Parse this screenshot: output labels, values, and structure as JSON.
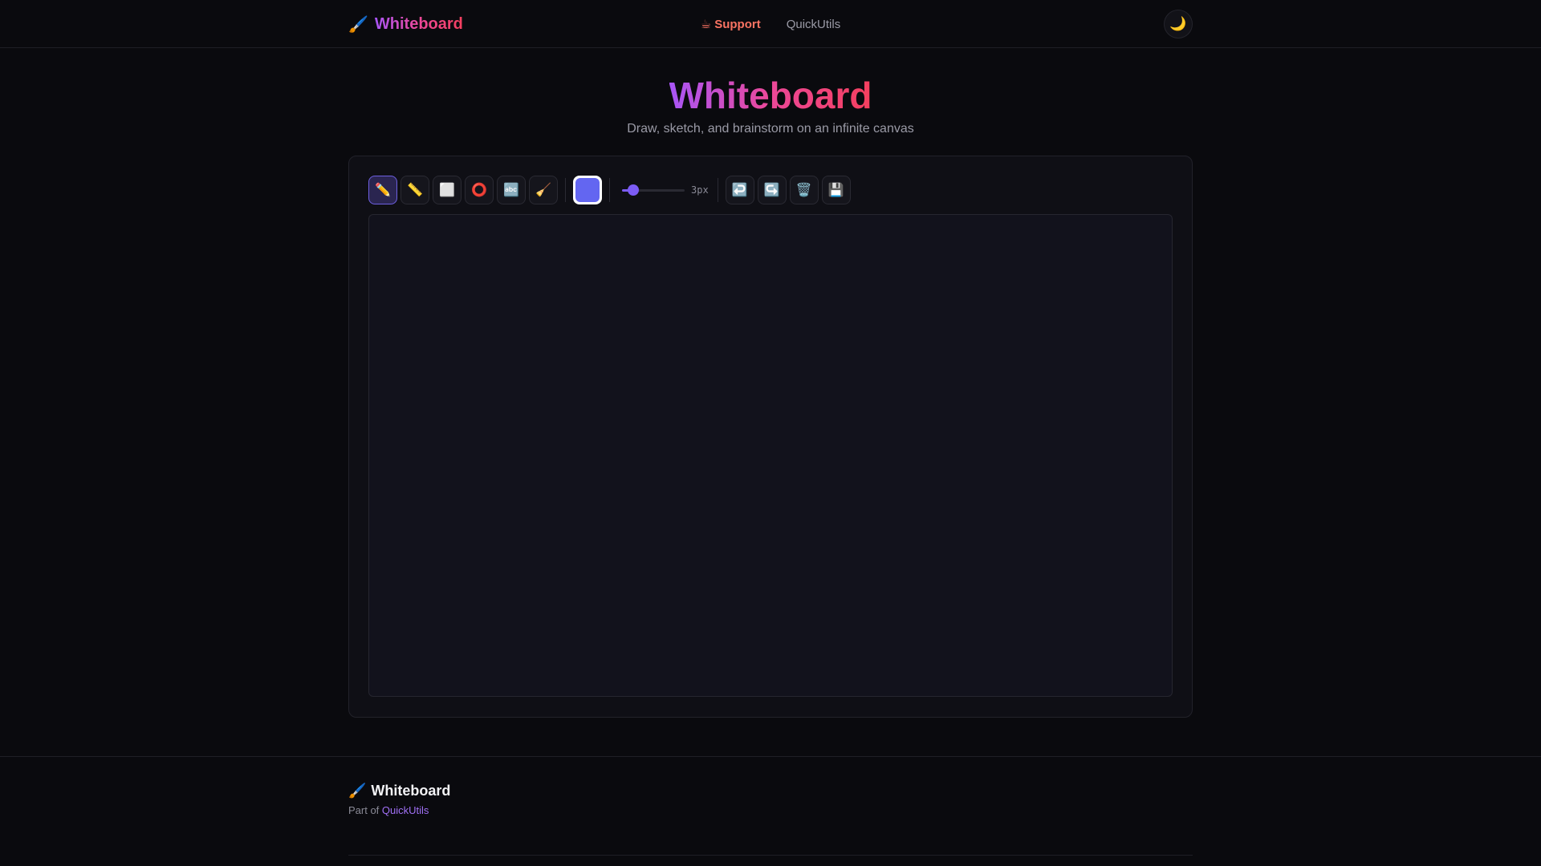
{
  "header": {
    "brand_icon": "🖌️",
    "brand_name": "Whiteboard",
    "support_icon": "☕",
    "support_label": "Support",
    "quickutils_label": "QuickUtils",
    "theme_icon": "🌙"
  },
  "hero": {
    "title": "Whiteboard",
    "subtitle": "Draw, sketch, and brainstorm on an infinite canvas"
  },
  "toolbar": {
    "tools": [
      {
        "name": "pencil-tool",
        "icon": "✏️",
        "icon_name": "pencil-icon",
        "active": true
      },
      {
        "name": "line-tool",
        "icon": "📏",
        "icon_name": "ruler-icon",
        "active": false
      },
      {
        "name": "rectangle-tool",
        "icon": "⬜",
        "icon_name": "square-icon",
        "active": false
      },
      {
        "name": "circle-tool",
        "icon": "⭕",
        "icon_name": "circle-icon",
        "active": false
      },
      {
        "name": "text-tool",
        "icon": "🔤",
        "icon_name": "text-icon",
        "active": false
      },
      {
        "name": "eraser-tool",
        "icon": "🧹",
        "icon_name": "broom-icon",
        "active": false
      }
    ],
    "color": "#6366f1",
    "brush_size": {
      "value": 3,
      "min": 1,
      "max": 20,
      "label": "3px"
    },
    "actions": [
      {
        "name": "undo-button",
        "icon": "↩️",
        "icon_name": "undo-icon"
      },
      {
        "name": "redo-button",
        "icon": "↪️",
        "icon_name": "redo-icon"
      },
      {
        "name": "clear-button",
        "icon": "🗑️",
        "icon_name": "trash-icon"
      },
      {
        "name": "save-button",
        "icon": "💾",
        "icon_name": "floppy-disk-icon"
      }
    ]
  },
  "footer": {
    "brand_icon": "🖌️",
    "brand_name": "Whiteboard",
    "part_of": "Part of",
    "part_link": "QuickUtils"
  }
}
